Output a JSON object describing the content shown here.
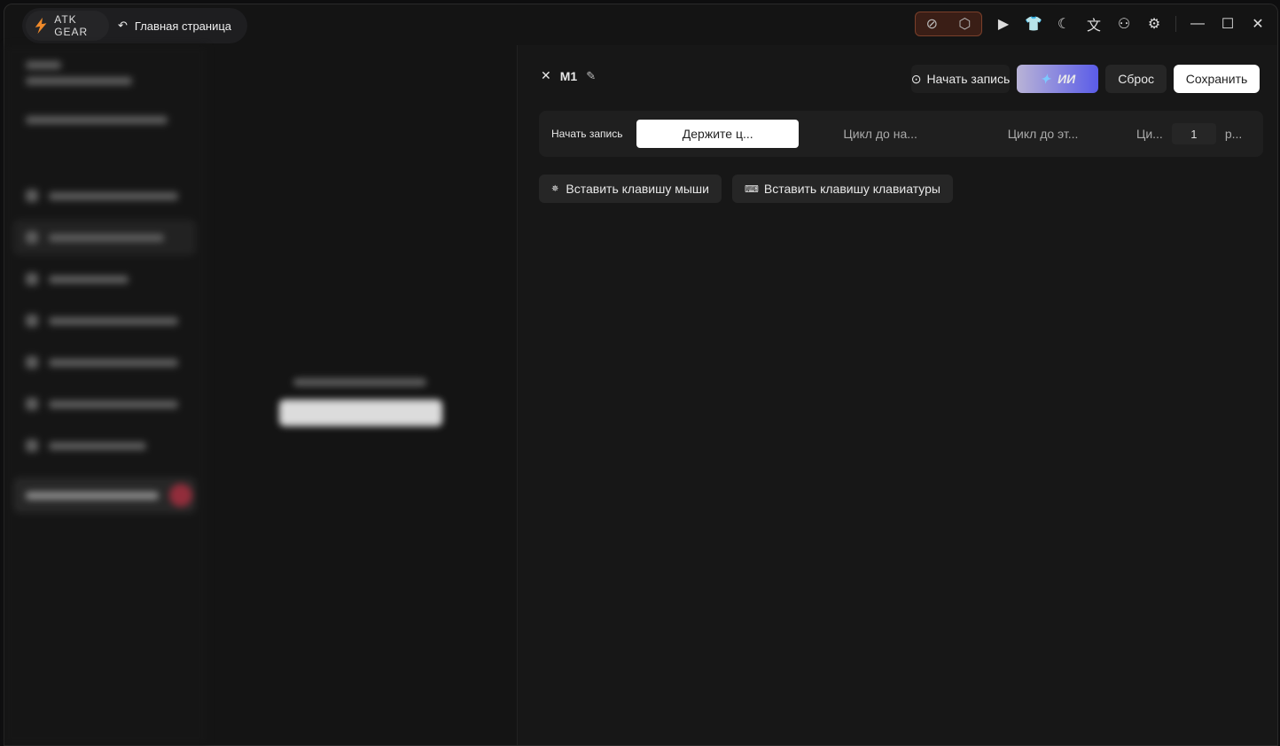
{
  "titlebar": {
    "brand": "ATK GEAR",
    "home_label": "Главная страница",
    "icons": [
      "block-icon",
      "cube-icon",
      "monitor-play-icon",
      "shirt-icon",
      "moon-icon",
      "translate-icon",
      "user-icon",
      "gear-icon",
      "minimize-icon",
      "maximize-icon",
      "close-icon"
    ]
  },
  "editor": {
    "macro_name": "M1",
    "start_record": "Начать запись",
    "ai": "ИИ",
    "reset": "Сброс",
    "save": "Сохранить",
    "record_label": "Начать запись",
    "modes": [
      "Держите ц...",
      "Цикл до на...",
      "Цикл до эт...",
      "Ци..."
    ],
    "repeat_value": "1",
    "repeat_suffix": "р...",
    "insert_mouse": "Вставить клавишу мыши",
    "insert_keyboard": "Вставить клавишу клавиатуры"
  },
  "colors": {
    "accent_ai_start": "#b9b3d6",
    "accent_ai_end": "#5a5ce8",
    "brand": "#f08a2a"
  }
}
